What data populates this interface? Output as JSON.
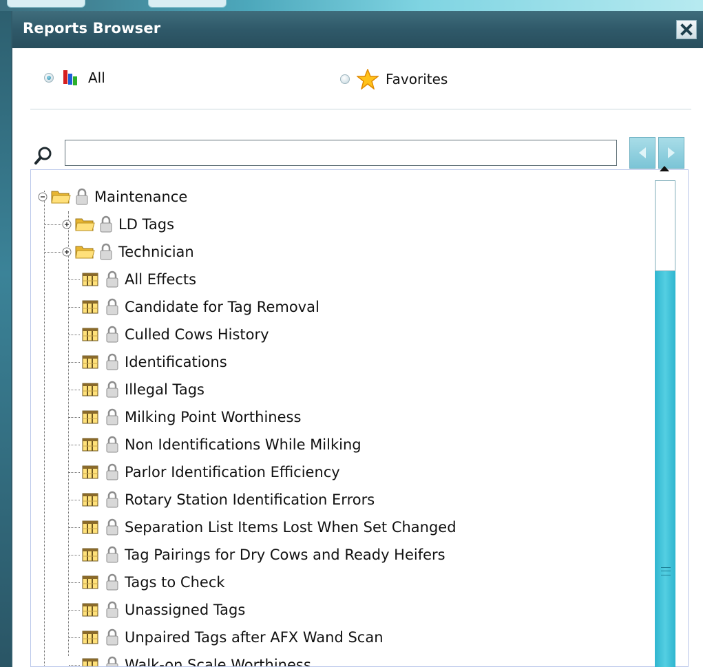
{
  "dialog": {
    "title": "Reports Browser"
  },
  "filter": {
    "options": [
      {
        "label": "All",
        "selected": true,
        "icon": "bar-chart-icon"
      },
      {
        "label": "Favorites",
        "selected": false,
        "icon": "star-icon"
      }
    ]
  },
  "search": {
    "value": "",
    "placeholder": ""
  },
  "tree": {
    "root": {
      "label": "Maintenance",
      "expanded": true
    },
    "folders": [
      {
        "label": "LD Tags",
        "expanded": false
      },
      {
        "label": "Technician",
        "expanded": false
      }
    ],
    "reports": [
      "All Effects",
      "Candidate for Tag Removal",
      "Culled Cows History",
      "Identifications",
      "Illegal Tags",
      "Milking Point Worthiness",
      "Non Identifications While Milking",
      "Parlor Identification Efficiency",
      "Rotary Station Identification Errors",
      "Separation List Items Lost When Set Changed",
      "Tag Pairings for Dry Cows and Ready Heifers",
      "Tags to Check",
      "Unassigned Tags",
      "Unpaired Tags after AFX Wand Scan",
      "Walk-on Scale Worthiness"
    ]
  },
  "colors": {
    "titlebar": "#2f5969",
    "scrollbar": "#2fb5cf",
    "folder": "#f2c84b",
    "lock": "#b9b9b9"
  }
}
